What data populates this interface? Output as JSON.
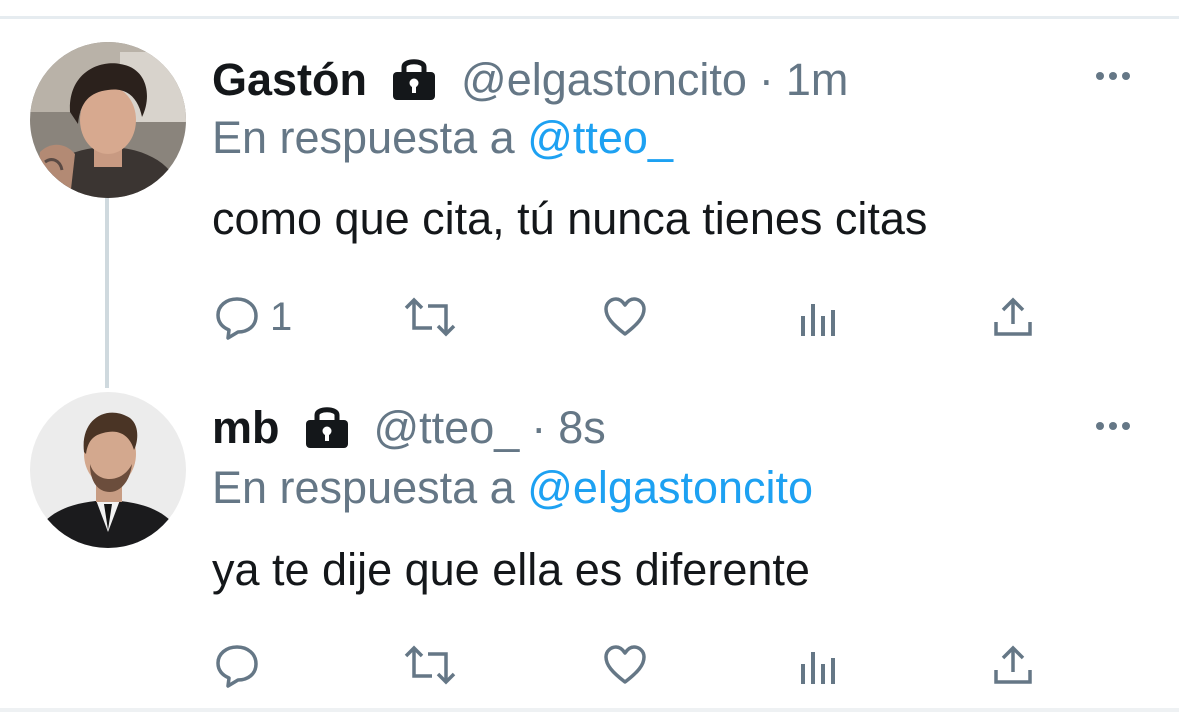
{
  "tweets": [
    {
      "name": "Gastón",
      "handle": "@elgastoncito",
      "separator": "·",
      "time": "1m",
      "reply_prefix": "En respuesta a",
      "reply_to": "@tteo_",
      "text": "como que cita, tú nunca tienes citas",
      "reply_count": "1",
      "icons": [
        "lock-icon",
        "reply-icon",
        "retweet-icon",
        "like-icon",
        "analytics-icon",
        "share-icon",
        "more-icon"
      ]
    },
    {
      "name": "mb",
      "handle": "@tteo_",
      "separator": "·",
      "time": "8s",
      "reply_prefix": "En respuesta a",
      "reply_to": "@elgastoncito",
      "text": "ya te dije que ella es diferente",
      "reply_count": "",
      "icons": [
        "lock-icon",
        "reply-icon",
        "retweet-icon",
        "like-icon",
        "analytics-icon",
        "share-icon",
        "more-icon"
      ]
    }
  ],
  "colors": {
    "text": "#14171a",
    "secondary": "#657786",
    "link": "#1da1f2",
    "divider": "#e6ecf0"
  }
}
